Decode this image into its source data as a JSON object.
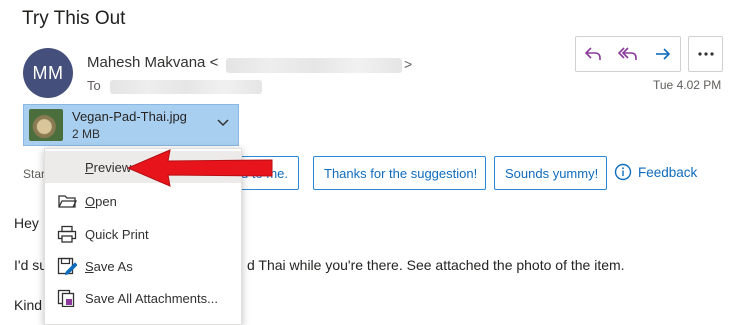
{
  "email": {
    "subject": "Try This Out",
    "avatar_initials": "MM",
    "sender_name": "Mahesh Makvana <",
    "sender_close": ">",
    "to_label": "To",
    "timestamp": "Tue 4.02 PM"
  },
  "actions": {
    "reply_icon": "reply-icon",
    "reply_all_icon": "reply-all-icon",
    "forward_icon": "forward-icon",
    "more_icon": "more-icon"
  },
  "attachment": {
    "filename": "Vegan-Pad-Thai.jpg",
    "size": "2 MB"
  },
  "suggested_replies": {
    "start_label": "Star",
    "items": [
      "od to me.",
      "Thanks for the suggestion!",
      "Sounds yummy!"
    ],
    "feedback_label": "Feedback"
  },
  "body": {
    "line1": "Hey",
    "line2_prefix": "I'd su",
    "line2_suffix": "d Thai while you're there. See attached the photo of the item.",
    "line3": "Kind"
  },
  "context_menu": {
    "items": [
      {
        "first": "P",
        "rest": "review",
        "icon": "preview-icon"
      },
      {
        "first": "O",
        "rest": "pen",
        "icon": "open-folder-icon"
      },
      {
        "first": "Quick P",
        "rest": "rint",
        "icon": "printer-icon"
      },
      {
        "first": "S",
        "rest": "ave As",
        "icon": "save-as-icon"
      },
      {
        "first": "Save All Attachments...",
        "rest": "",
        "icon": "save-all-attachments-icon"
      }
    ]
  },
  "colors": {
    "accent": "#0f6cbd",
    "avatar_bg": "#454f7c",
    "attachment_bg": "#a9cff0",
    "arrow": "#e8141b"
  }
}
